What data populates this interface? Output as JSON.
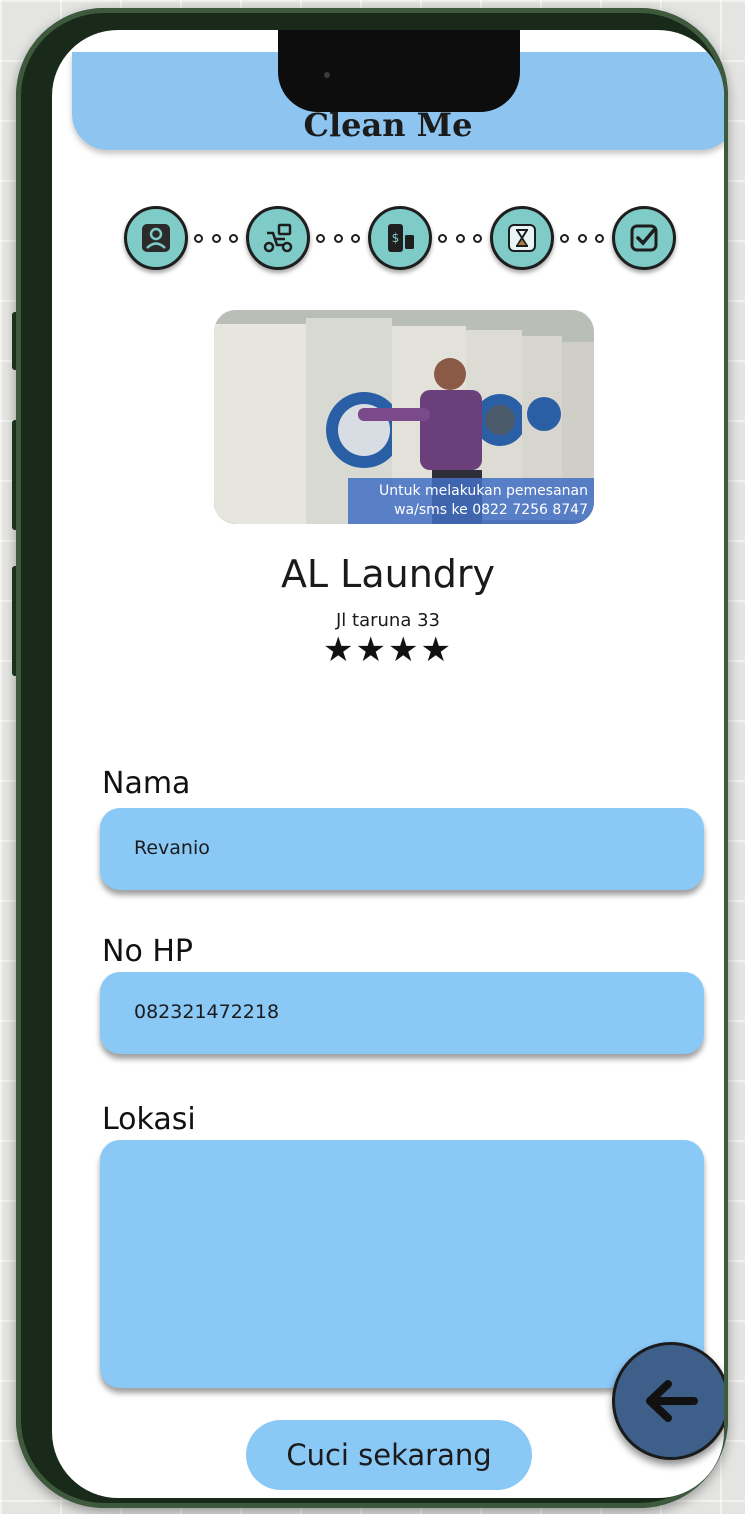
{
  "app": {
    "title": "Clean Me"
  },
  "steps": [
    {
      "icon": "user-icon"
    },
    {
      "icon": "scooter-delivery-icon"
    },
    {
      "icon": "payment-icon"
    },
    {
      "icon": "hourglass-icon"
    },
    {
      "icon": "checkmark-icon"
    }
  ],
  "hero": {
    "caption_line1": "Untuk melakukan pemesanan",
    "caption_line2": "wa/sms ke 0822 7256 8747"
  },
  "store": {
    "name": "AL Laundry",
    "address": "Jl taruna 33",
    "stars": "★★★★"
  },
  "form": {
    "nama_label": "Nama",
    "nama_value": "Revanio",
    "hp_label": "No HP",
    "hp_value": "082321472218",
    "lokasi_label": "Lokasi",
    "lokasi_value": ""
  },
  "actions": {
    "submit_label": "Cuci sekarang"
  },
  "colors": {
    "accent": "#8ac8f6",
    "step": "#7fcbc8",
    "fab": "#3d5f8a",
    "frame": "#1a2a1a"
  }
}
